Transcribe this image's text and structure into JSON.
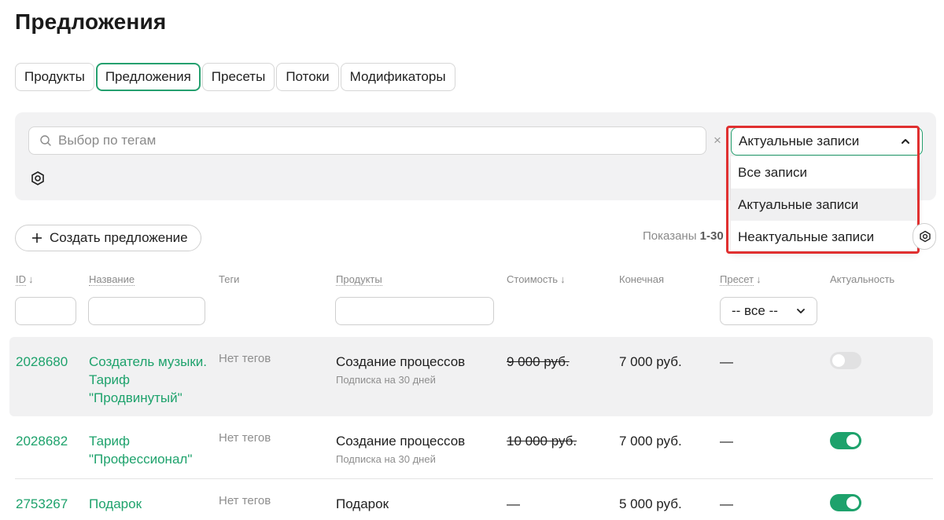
{
  "page": {
    "title": "Предложения"
  },
  "tabs": [
    {
      "label": "Продукты",
      "active": false
    },
    {
      "label": "Предложения",
      "active": true
    },
    {
      "label": "Пресеты",
      "active": false
    },
    {
      "label": "Потоки",
      "active": false
    },
    {
      "label": "Модификаторы",
      "active": false
    }
  ],
  "filters": {
    "tag_placeholder": "Выбор по тегам",
    "clear_symbol": "×",
    "status_select": {
      "value": "Актуальные записи",
      "options": [
        "Все записи",
        "Актуальные записи",
        "Неактуальные записи"
      ]
    }
  },
  "toolbar": {
    "create_label": "Создать предложение",
    "shown_prefix": "Показаны",
    "shown_range": "1-30"
  },
  "table": {
    "headers": {
      "id": "ID",
      "name": "Название",
      "tags": "Теги",
      "products": "Продукты",
      "cost": "Стоимость",
      "final": "Конечная",
      "preset": "Пресет",
      "active": "Актуальность"
    },
    "sort_arrow": "↓",
    "preset_filter_value": "-- все --",
    "rows": [
      {
        "id": "2028680",
        "name": "Создатель музыки. Тариф \"Продвинутый\"",
        "tags": "Нет тегов",
        "product": "Создание процессов",
        "product_sub": "Подписка на 30 дней",
        "cost": "9 000 руб.",
        "final": "7 000 руб.",
        "preset": "—",
        "active": false
      },
      {
        "id": "2028682",
        "name": "Тариф \"Профессионал\"",
        "tags": "Нет тегов",
        "product": "Создание процессов",
        "product_sub": "Подписка на 30 дней",
        "cost": "10 000 руб.",
        "final": "7 000 руб.",
        "preset": "—",
        "active": true
      },
      {
        "id": "2753267",
        "name": "Подарок",
        "tags": "Нет тегов",
        "product": "Подарок",
        "product_sub": "",
        "cost": "—",
        "final": "5 000 руб.",
        "preset": "—",
        "active": true
      }
    ]
  },
  "colors": {
    "accent": "#1ea26c",
    "highlight": "#e03030",
    "panel": "#f2f2f3"
  }
}
